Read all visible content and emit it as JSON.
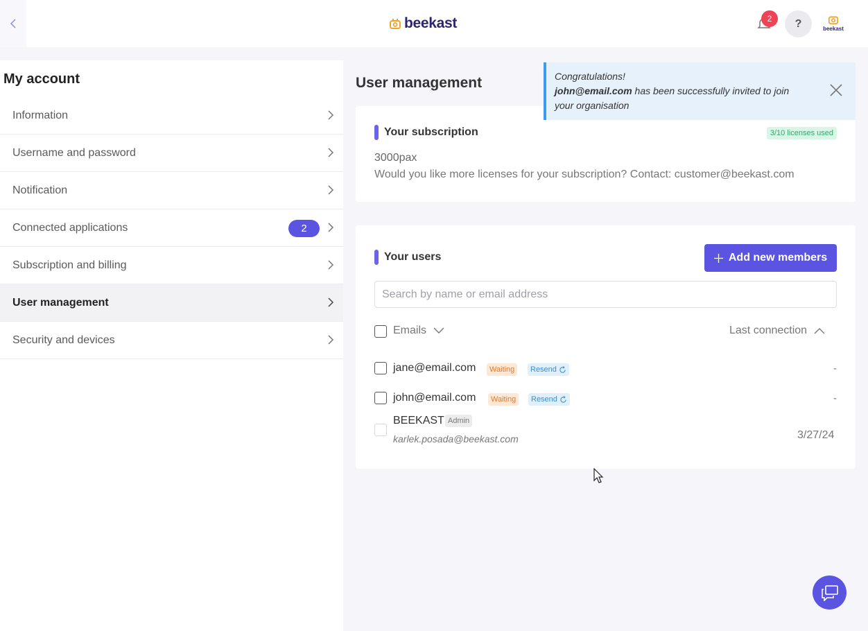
{
  "header": {
    "logo_text": "beekast",
    "notification_count": "2",
    "help_label": "?",
    "org_logo_text": "beekast"
  },
  "sidebar": {
    "title": "My account",
    "items": [
      {
        "label": "Information"
      },
      {
        "label": "Username and password"
      },
      {
        "label": "Notification"
      },
      {
        "label": "Connected applications",
        "badge": "2"
      },
      {
        "label": "Subscription and billing"
      },
      {
        "label": "User management",
        "active": true
      },
      {
        "label": "Security and devices"
      }
    ]
  },
  "main": {
    "title": "User management",
    "subscription": {
      "title": "Your subscription",
      "licenses_badge": "3/10 licenses used",
      "plan": "3000pax",
      "contact_text": "Would you like more licenses for your subscription? Contact: customer@beekast.com"
    },
    "users": {
      "title": "Your users",
      "add_button": "Add new members",
      "search_placeholder": "Search by name or email address",
      "col_emails": "Emails",
      "col_last_connection": "Last connection",
      "rows": [
        {
          "email": "jane@email.com",
          "status": "Waiting",
          "resend": "Resend",
          "last_connection": "-"
        },
        {
          "email": "john@email.com",
          "status": "Waiting",
          "resend": "Resend",
          "last_connection": "-"
        },
        {
          "name": "BEEKAST",
          "role": "Admin",
          "email": "karlek.posada@beekast.com",
          "last_connection": "3/27/24"
        }
      ]
    }
  },
  "toast": {
    "line1": "Congratulations!",
    "email": "john@email.com",
    "message": " has been successfully invited to join your organisation"
  },
  "colors": {
    "accent": "#5b54e0",
    "brand_orange": "#f2a32c",
    "toast_border": "#3d9be9"
  }
}
